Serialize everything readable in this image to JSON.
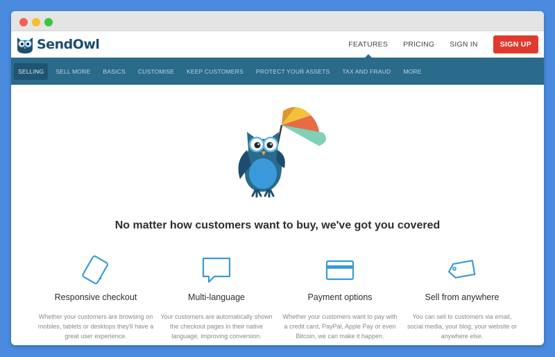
{
  "brand": {
    "name": "SendOwl",
    "logo_icon": "owl-logo-icon"
  },
  "topnav": {
    "features": "FEATURES",
    "pricing": "PRICING",
    "signin": "SIGN IN",
    "signup": "SIGN UP"
  },
  "subnav": {
    "items": [
      {
        "label": "SELLING",
        "active": true
      },
      {
        "label": "SELL MORE"
      },
      {
        "label": "BASICS"
      },
      {
        "label": "CUSTOMISE"
      },
      {
        "label": "KEEP CUSTOMERS"
      },
      {
        "label": "PROTECT YOUR ASSETS"
      },
      {
        "label": "TAX AND FRAUD"
      },
      {
        "label": "MORE"
      }
    ]
  },
  "hero": {
    "illustration": "owl-with-umbrella-illustration",
    "headline": "No matter how customers want to buy, we've got you covered"
  },
  "features": [
    {
      "icon": "tablet-icon",
      "title": "Responsive checkout",
      "desc": "Whether your customers are browsing on mobiles, tablets or desktops they'll have a great user experience."
    },
    {
      "icon": "speech-bubble-icon",
      "title": "Multi-language",
      "desc": "Your customers are automatically shown the checkout pages in their native language, improving conversion."
    },
    {
      "icon": "credit-card-icon",
      "title": "Payment options",
      "desc": "Whether your customers want to pay with a credit card, PayPal, Apple Pay or even Bitcoin, we can make it happen."
    },
    {
      "icon": "price-tag-icon",
      "title": "Sell from anywhere",
      "desc": "You can sell to customers via email, social media, your blog, your website or anywhere else."
    }
  ],
  "colors": {
    "background": "#4a8be0",
    "nav_blue": "#2a6a8a",
    "signup_red": "#e03a2f",
    "icon_blue": "#3a9ad9"
  }
}
